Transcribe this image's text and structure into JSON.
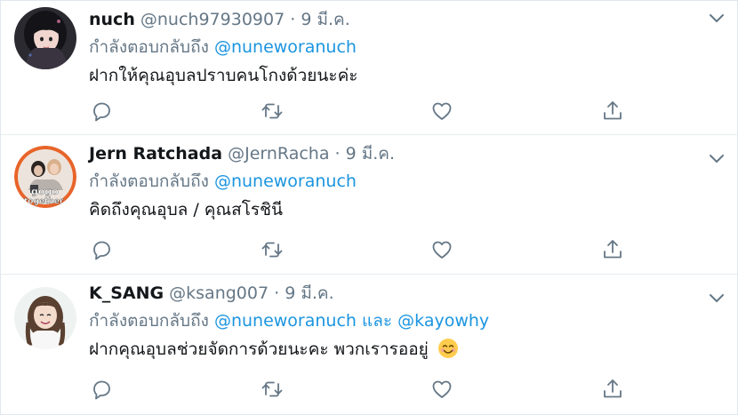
{
  "reply_prefix": "กำลังตอบกลับถึง",
  "and_word": "และ",
  "tweets": [
    {
      "name": "nuch",
      "handle": "@nuch97930907",
      "separator": "·",
      "date": "9 มี.ค.",
      "mention1": "@nuneworanuch",
      "text": "ฝากให้คุณอุบลปราบคนโกงด้วยนะค่ะ",
      "avatar_icon": "avatar-dark-hair"
    },
    {
      "name": "Jern Ratchada",
      "handle": "@JernRacha",
      "separator": "·",
      "date": "9 มี.ค.",
      "mention1": "@nuneworanuch",
      "text": "คิดถึงคุณอุบล / คุณสโรชินี",
      "avatar_icon": "avatar-gogo-together",
      "avatar_text_1": "gogo",
      "avatar_text_2": "together"
    },
    {
      "name": "K_SANG",
      "handle": "@ksang007",
      "separator": "·",
      "date": "9 มี.ค.",
      "mention1": "@nuneworanuch",
      "mention2": "@kayowhy",
      "text": "ฝากคุณอุบลช่วยจัดการด้วยนะคะ พวกเรารออยู่",
      "emoji": "smiling-face-emoji",
      "avatar_icon": "avatar-smiling-woman"
    }
  ],
  "colors": {
    "link": "#1b95e0",
    "secondary": "#657786",
    "primary": "#14171a",
    "divider": "#e6ecf0"
  }
}
